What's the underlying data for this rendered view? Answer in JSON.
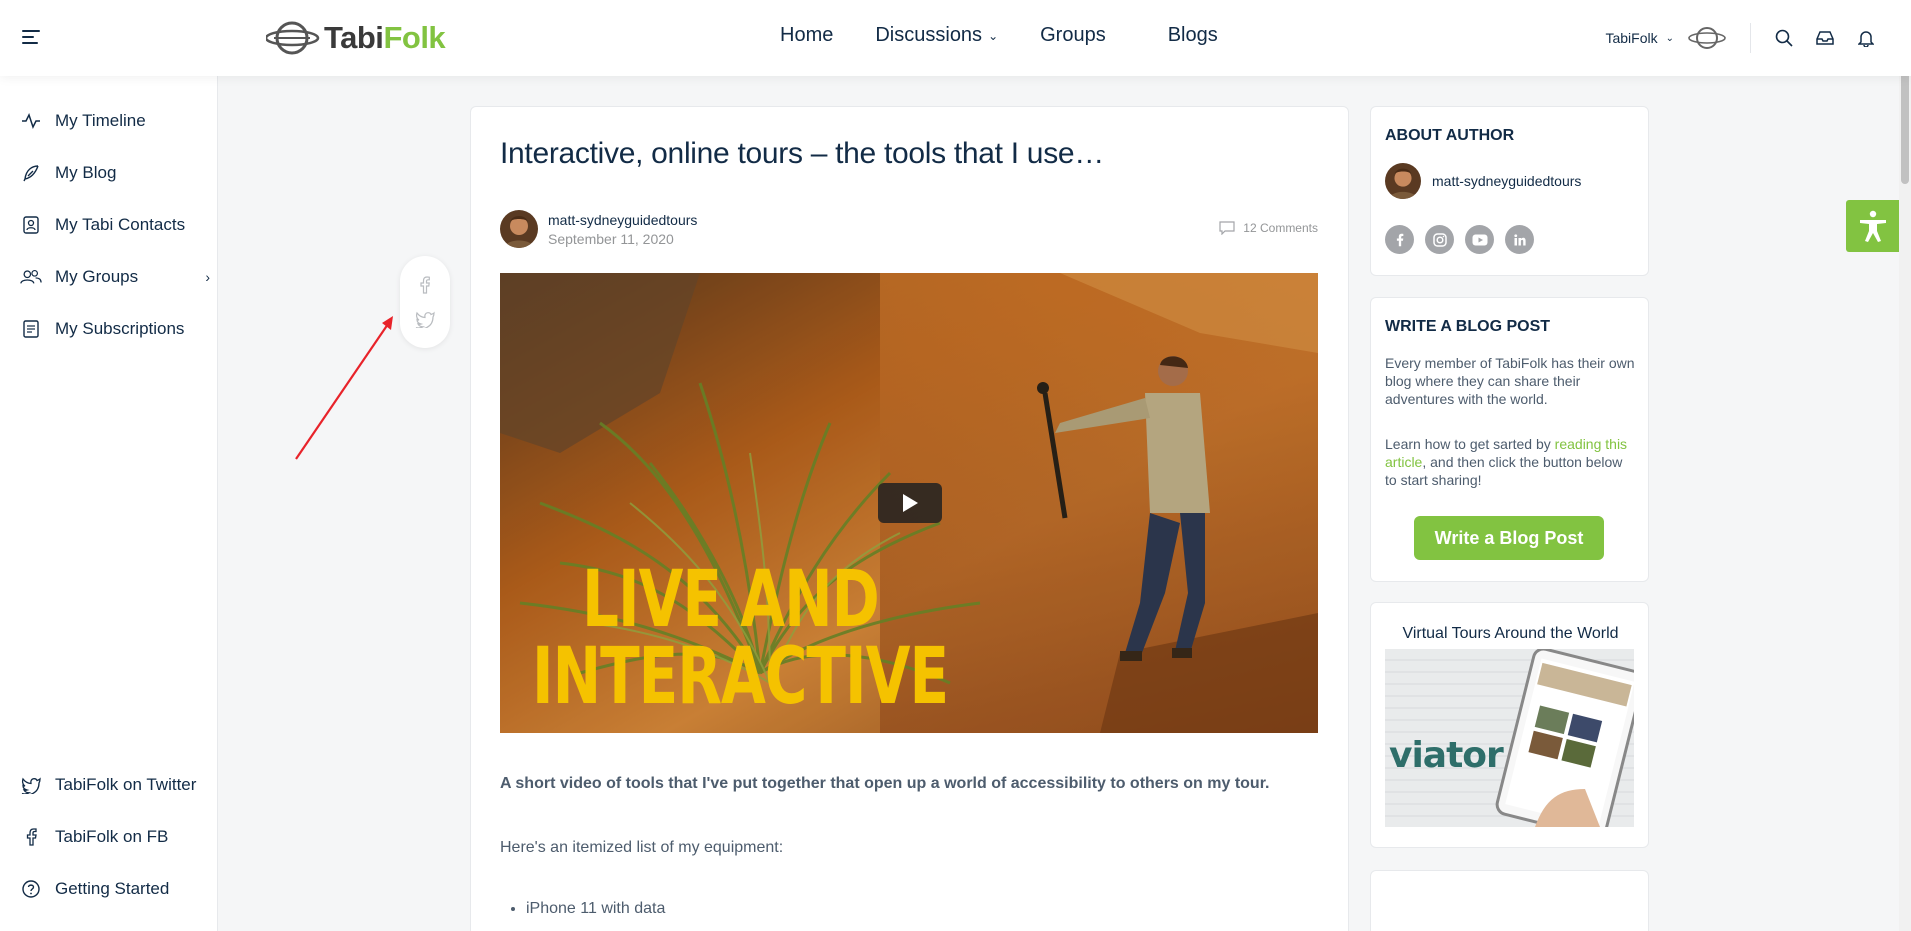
{
  "header": {
    "logo_text_a": "Tabi",
    "logo_text_b": "Fo",
    "logo_text_c": "lk",
    "nav": [
      "Home",
      "Discussions",
      "Groups",
      "Blogs"
    ],
    "user_name": "TabiFolk"
  },
  "sidebar": {
    "items": [
      {
        "label": "My Timeline",
        "icon": "activity-icon"
      },
      {
        "label": "My Blog",
        "icon": "feather-icon"
      },
      {
        "label": "My Tabi Contacts",
        "icon": "contacts-icon"
      },
      {
        "label": "My Groups",
        "icon": "groups-icon"
      },
      {
        "label": "My Subscriptions",
        "icon": "subscriptions-icon"
      }
    ],
    "bottom_items": [
      {
        "label": "TabiFolk on Twitter",
        "icon": "twitter-icon"
      },
      {
        "label": "TabiFolk on FB",
        "icon": "facebook-icon"
      },
      {
        "label": "Getting Started",
        "icon": "help-icon"
      }
    ]
  },
  "post": {
    "title": "Interactive, online tours – the tools that I use…",
    "author": "matt-sydneyguidedtours",
    "date": "September 11, 2020",
    "comments": "12 Comments",
    "video_text_line1": "LIVE AND",
    "video_text_line2": "INTERACTIVE",
    "lead": "A short video of tools that I've put together that open up a world of accessibility to others on my tour.",
    "para": "Here's an itemized list of my equipment:",
    "list": [
      "iPhone 11 with data"
    ]
  },
  "widgets": {
    "about": {
      "title": "ABOUT AUTHOR",
      "author": "matt-sydneyguidedtours"
    },
    "write": {
      "title": "WRITE A BLOG POST",
      "text1": "Every member of TabiFolk has their own blog where they can share their adventures with the world.",
      "text2_a": "Learn how to get sarted by ",
      "text2_link": "reading this article",
      "text2_b": ", and then click the button below to start sharing!",
      "button": "Write a Blog Post"
    },
    "ad": {
      "title": "Virtual Tours Around the World",
      "brand": "viator"
    }
  },
  "colors": {
    "accent": "#82c341",
    "text": "#122b46",
    "video_text": "#f5c200"
  }
}
